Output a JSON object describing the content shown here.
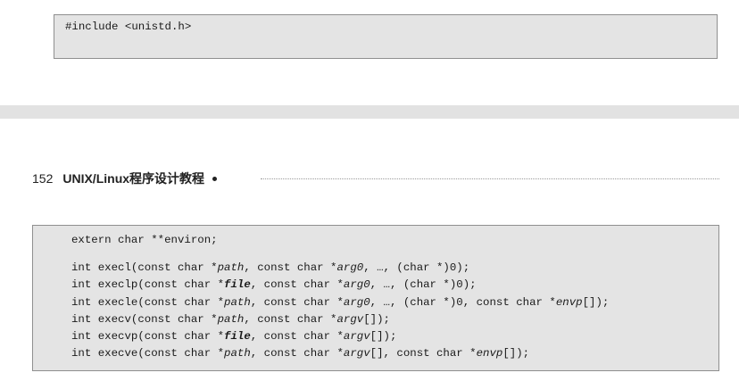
{
  "code_top": {
    "line": "#include <unistd.h>"
  },
  "header": {
    "page_number": "152",
    "book_title": "UNIX/Linux程序设计教程"
  },
  "code_bottom": {
    "environ_line": "extern char **environ;",
    "lines": [
      [
        {
          "t": "int execl(const char *",
          "s": ""
        },
        {
          "t": "path",
          "s": "i"
        },
        {
          "t": ", const char *",
          "s": ""
        },
        {
          "t": "arg0",
          "s": "i"
        },
        {
          "t": ", …, (char *)0);",
          "s": ""
        }
      ],
      [
        {
          "t": "int execlp(const char *",
          "s": ""
        },
        {
          "t": "file",
          "s": "b"
        },
        {
          "t": ", const char *",
          "s": ""
        },
        {
          "t": "arg0",
          "s": "i"
        },
        {
          "t": ", …, (char *)0);",
          "s": ""
        }
      ],
      [
        {
          "t": "int execle(const char *",
          "s": ""
        },
        {
          "t": "path",
          "s": "i"
        },
        {
          "t": ", const char *",
          "s": ""
        },
        {
          "t": "arg0",
          "s": "i"
        },
        {
          "t": ", …, (char *)0, const char *",
          "s": ""
        },
        {
          "t": "envp",
          "s": "i"
        },
        {
          "t": "[]);",
          "s": ""
        }
      ],
      [
        {
          "t": "int execv(const char *",
          "s": ""
        },
        {
          "t": "path",
          "s": "i"
        },
        {
          "t": ", const char *",
          "s": ""
        },
        {
          "t": "argv",
          "s": "i"
        },
        {
          "t": "[]);",
          "s": ""
        }
      ],
      [
        {
          "t": "int execvp(const char *",
          "s": ""
        },
        {
          "t": "file",
          "s": "b"
        },
        {
          "t": ", const char *",
          "s": ""
        },
        {
          "t": "argv",
          "s": "i"
        },
        {
          "t": "[]);",
          "s": ""
        }
      ],
      [
        {
          "t": "int execve(const char *",
          "s": ""
        },
        {
          "t": "path",
          "s": "i"
        },
        {
          "t": ", const char *",
          "s": ""
        },
        {
          "t": "argv",
          "s": "i"
        },
        {
          "t": "[], const char *",
          "s": ""
        },
        {
          "t": "envp",
          "s": "i"
        },
        {
          "t": "[]);",
          "s": ""
        }
      ]
    ]
  }
}
